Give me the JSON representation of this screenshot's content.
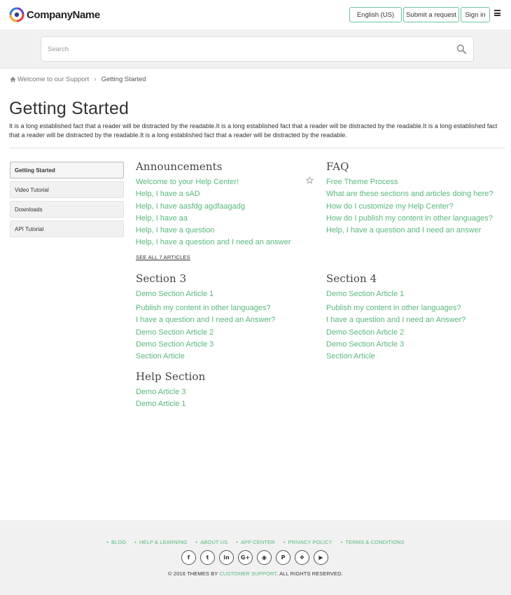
{
  "header": {
    "company_name": "CompanyName",
    "language_label": "English (US)",
    "submit_label": "Submit a request",
    "signin_label": "Sign in"
  },
  "search": {
    "placeholder": "Search"
  },
  "breadcrumb": {
    "home": "Welcome to our Support",
    "current": "Getting Started"
  },
  "page": {
    "title": "Getting Started",
    "description": "It is a long established fact that a reader will be distracted by the readable.It is a long established fact that a reader will be distracted by the readable.It is a long established fact that a reader will be distracted by the readable.It is a long established fact that a reader will be distracted by the readable."
  },
  "sidebar": {
    "items": [
      {
        "label": "Getting Started"
      },
      {
        "label": "Video Tutorial"
      },
      {
        "label": "Downloads"
      },
      {
        "label": "API Tutorial"
      }
    ]
  },
  "sections": {
    "announcements": {
      "title": "Announcements",
      "articles": [
        "Welcome to your Help Center!",
        "Help, I have a sAD",
        "Help, I have aasfdg agdfaagadg",
        "Help, I have aa",
        "Help, I have a question",
        "Help, I have a question and I need an answer"
      ],
      "see_all": "SEE ALL 7 ARTICLES"
    },
    "faq": {
      "title": "FAQ",
      "articles": [
        "Free Theme Process",
        "What are these sections and articles doing here?",
        "How do I customize my Help Center?",
        "How do I publish my content in other languages?",
        "Help, I have a question and I need an answer"
      ]
    },
    "section3": {
      "title": "Section 3",
      "articles": [
        "Demo Section Article 1",
        "Publish my content in other languages?",
        "I have a question and I need an Answer?",
        "Demo Section Article 2",
        "Demo Section Article 3",
        "Section Article"
      ]
    },
    "section4": {
      "title": "Section 4",
      "articles": [
        "Demo Section Article 1",
        "Publish my content in other languages?",
        "I have a question and I need an Answer?",
        "Demo Section Article 2",
        "Demo Section Article 3",
        "Section Article"
      ]
    },
    "help": {
      "title": "Help Section",
      "articles": [
        "Demo Article 3",
        "Demo Article 1"
      ]
    }
  },
  "footer": {
    "links": [
      "BLOG",
      "HELP & LEARNING",
      "ABOUT US",
      "APP CENTER",
      "PRIVACY POLICY",
      "TERMS & CONDITIONS"
    ],
    "social": [
      {
        "icon": "facebook-icon",
        "glyph": "f"
      },
      {
        "icon": "twitter-icon",
        "glyph": "t"
      },
      {
        "icon": "linkedin-icon",
        "glyph": "in"
      },
      {
        "icon": "google-plus-icon",
        "glyph": "G+"
      },
      {
        "icon": "github-icon",
        "glyph": "◉"
      },
      {
        "icon": "pinterest-icon",
        "glyph": "P"
      },
      {
        "icon": "dropbox-icon",
        "glyph": "❖"
      },
      {
        "icon": "youtube-icon",
        "glyph": "▶"
      }
    ],
    "copyright_prefix": "© 2016 THEMES BY ",
    "copyright_link": "CUSTOMER SUPPORT",
    "copyright_suffix": ". ALL RIGHTS RESERVED."
  },
  "colors": {
    "accent": "#58b87a",
    "button_border": "#6cc49c",
    "band": "#f1f1f1"
  }
}
